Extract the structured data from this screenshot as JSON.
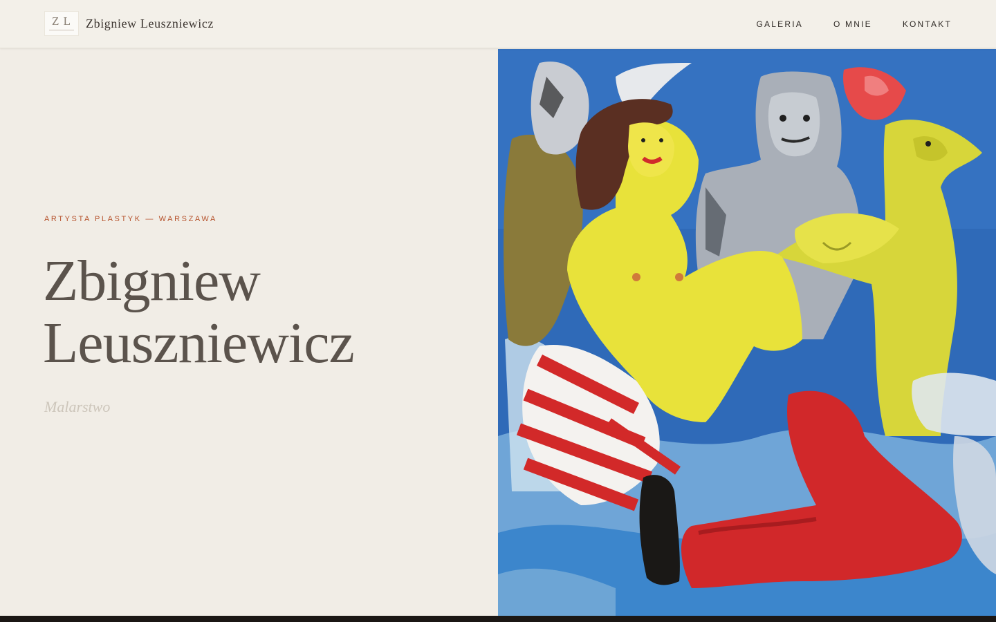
{
  "header": {
    "logo_mark": "Z L",
    "brand_name": "Zbigniew Leuszniewicz",
    "nav": [
      {
        "label": "GALERIA"
      },
      {
        "label": "O MNIE"
      },
      {
        "label": "KONTAKT"
      }
    ]
  },
  "hero": {
    "eyebrow": "ARTYSTA PLASTYK — WARSZAWA",
    "title_line1": "Zbigniew",
    "title_line2": "Leuszniewicz",
    "subtitle": "Malarstwo"
  },
  "painting": {
    "icon": "painting-artwork"
  },
  "colors": {
    "background": "#f1ede6",
    "accent": "#b6532d",
    "title": "#5b534c",
    "footer": "#1b1714"
  }
}
